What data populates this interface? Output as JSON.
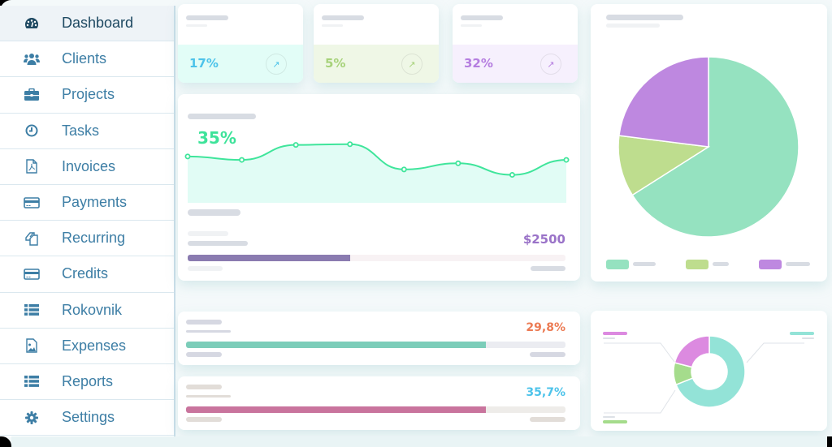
{
  "sidebar": {
    "items": [
      {
        "label": "Dashboard",
        "icon": "dashboard-gauge-icon",
        "active": true
      },
      {
        "label": "Clients",
        "icon": "users-icon"
      },
      {
        "label": "Projects",
        "icon": "briefcase-icon"
      },
      {
        "label": "Tasks",
        "icon": "clock-icon"
      },
      {
        "label": "Invoices",
        "icon": "pdf-file-icon"
      },
      {
        "label": "Payments",
        "icon": "credit-card-icon"
      },
      {
        "label": "Recurring",
        "icon": "copy-files-icon"
      },
      {
        "label": "Credits",
        "icon": "credit-card-icon"
      },
      {
        "label": "Rokovnik",
        "icon": "list-icon"
      },
      {
        "label": "Expenses",
        "icon": "image-file-icon"
      },
      {
        "label": "Reports",
        "icon": "list-icon"
      },
      {
        "label": "Settings",
        "icon": "gear-icon"
      }
    ],
    "colors": {
      "text": "#3d7ea5",
      "active_text": "#1e4962"
    }
  },
  "stat_cards": [
    {
      "value": "17%",
      "color": "#4dc3ea",
      "bg": "#e2fdf7",
      "icon": "arrow-up-right-icon"
    },
    {
      "value": "5%",
      "color": "#a7d27a",
      "bg": "#eff7e6",
      "icon": "arrow-up-right-icon"
    },
    {
      "value": "32%",
      "color": "#b57ee0",
      "bg": "#f6f0fd",
      "icon": "arrow-up-right-icon"
    }
  ],
  "line_card": {
    "percent": "35%",
    "percent_color": "#3ee39a",
    "amount": "$2500",
    "amount_color": "#9a73c8",
    "progress": 0.43,
    "progress_color": "#8a7bb0"
  },
  "progress_cards": [
    {
      "value": "29,8%",
      "value_color": "#ec7b54",
      "progress": 0.79,
      "bar_color": "#7ccdb9",
      "track": "#ebecf1"
    },
    {
      "value": "35,7%",
      "value_color": "#4dc3ea",
      "progress": 0.79,
      "bar_color": "#c9749d",
      "track": "#eeece9"
    }
  ],
  "chart_data": [
    {
      "type": "line",
      "title": "",
      "x": [
        1,
        2,
        3,
        4,
        5,
        6,
        7,
        8
      ],
      "values": [
        68,
        63,
        85,
        86,
        49,
        58,
        41,
        63
      ],
      "ylim": [
        0,
        100
      ],
      "color": "#3fe59b",
      "fill": "#e1fcf5",
      "grid": false
    },
    {
      "type": "pie",
      "slices": [
        {
          "label": "",
          "value": 66,
          "color": "#95e2c0"
        },
        {
          "label": "",
          "value": 11,
          "color": "#bedd8e"
        },
        {
          "label": "",
          "value": 23,
          "color": "#be88e0"
        }
      ],
      "legend": "bottom"
    },
    {
      "type": "pie",
      "variant": "donut",
      "slices": [
        {
          "label": "",
          "value": 69,
          "color": "#93e3d7"
        },
        {
          "label": "",
          "value": 10,
          "color": "#a5dc8c"
        },
        {
          "label": "",
          "value": 21,
          "color": "#dc8ae0"
        }
      ],
      "legend": "callouts"
    }
  ]
}
